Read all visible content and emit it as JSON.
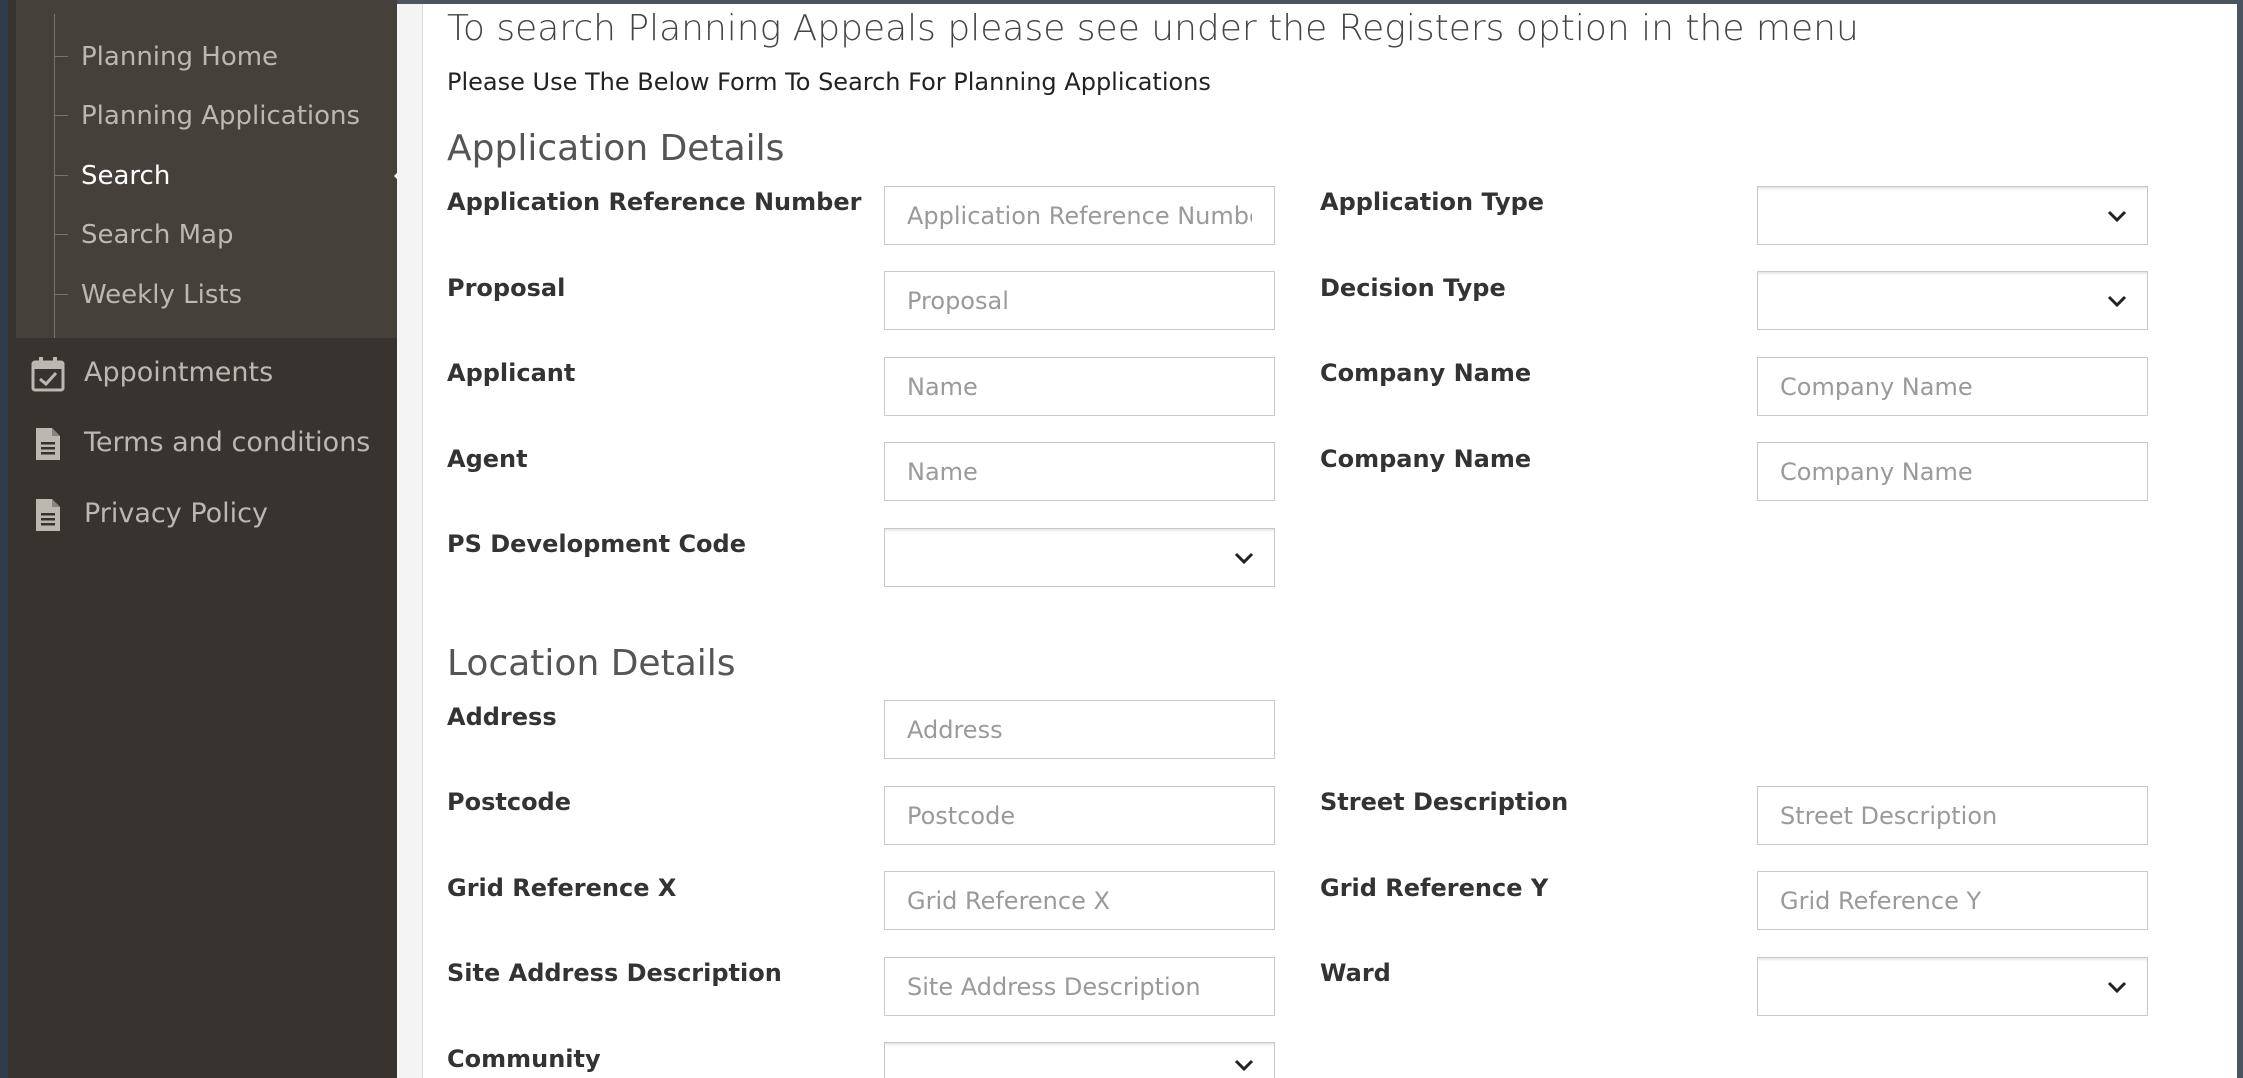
{
  "sidebar": {
    "submenu": [
      {
        "label": "Planning Home"
      },
      {
        "label": "Planning Applications"
      },
      {
        "label": "Search"
      },
      {
        "label": "Search Map"
      },
      {
        "label": "Weekly Lists"
      }
    ],
    "menu": [
      {
        "label": "Appointments",
        "icon": "calendar-check-icon"
      },
      {
        "label": "Terms and conditions",
        "icon": "document-icon"
      },
      {
        "label": "Privacy Policy",
        "icon": "document-icon"
      }
    ]
  },
  "main": {
    "notice": "To search Planning Appeals please see under the Registers option in the menu",
    "instruction": "Please Use The Below Form To Search For Planning Applications",
    "application_section": {
      "title": "Application Details",
      "fields": {
        "ref_label": "Application Reference Number",
        "ref_placeholder": "Application Reference Number",
        "app_type_label": "Application Type",
        "proposal_label": "Proposal",
        "proposal_placeholder": "Proposal",
        "decision_type_label": "Decision Type",
        "applicant_label": "Applicant",
        "applicant_placeholder": "Name",
        "applicant_company_label": "Company Name",
        "applicant_company_placeholder": "Company Name",
        "agent_label": "Agent",
        "agent_placeholder": "Name",
        "agent_company_label": "Company Name",
        "agent_company_placeholder": "Company Name",
        "ps_code_label": "PS Development Code"
      }
    },
    "location_section": {
      "title": "Location Details",
      "fields": {
        "address_label": "Address",
        "address_placeholder": "Address",
        "postcode_label": "Postcode",
        "postcode_placeholder": "Postcode",
        "street_label": "Street Description",
        "street_placeholder": "Street Description",
        "gridx_label": "Grid Reference X",
        "gridx_placeholder": "Grid Reference X",
        "gridy_label": "Grid Reference Y",
        "gridy_placeholder": "Grid Reference Y",
        "site_label": "Site Address Description",
        "site_placeholder": "Site Address Description",
        "ward_label": "Ward",
        "community_label": "Community"
      }
    }
  },
  "colors": {
    "sidebar_bg": "#38332e",
    "submenu_bg": "#45403a",
    "label_text": "#333333"
  }
}
